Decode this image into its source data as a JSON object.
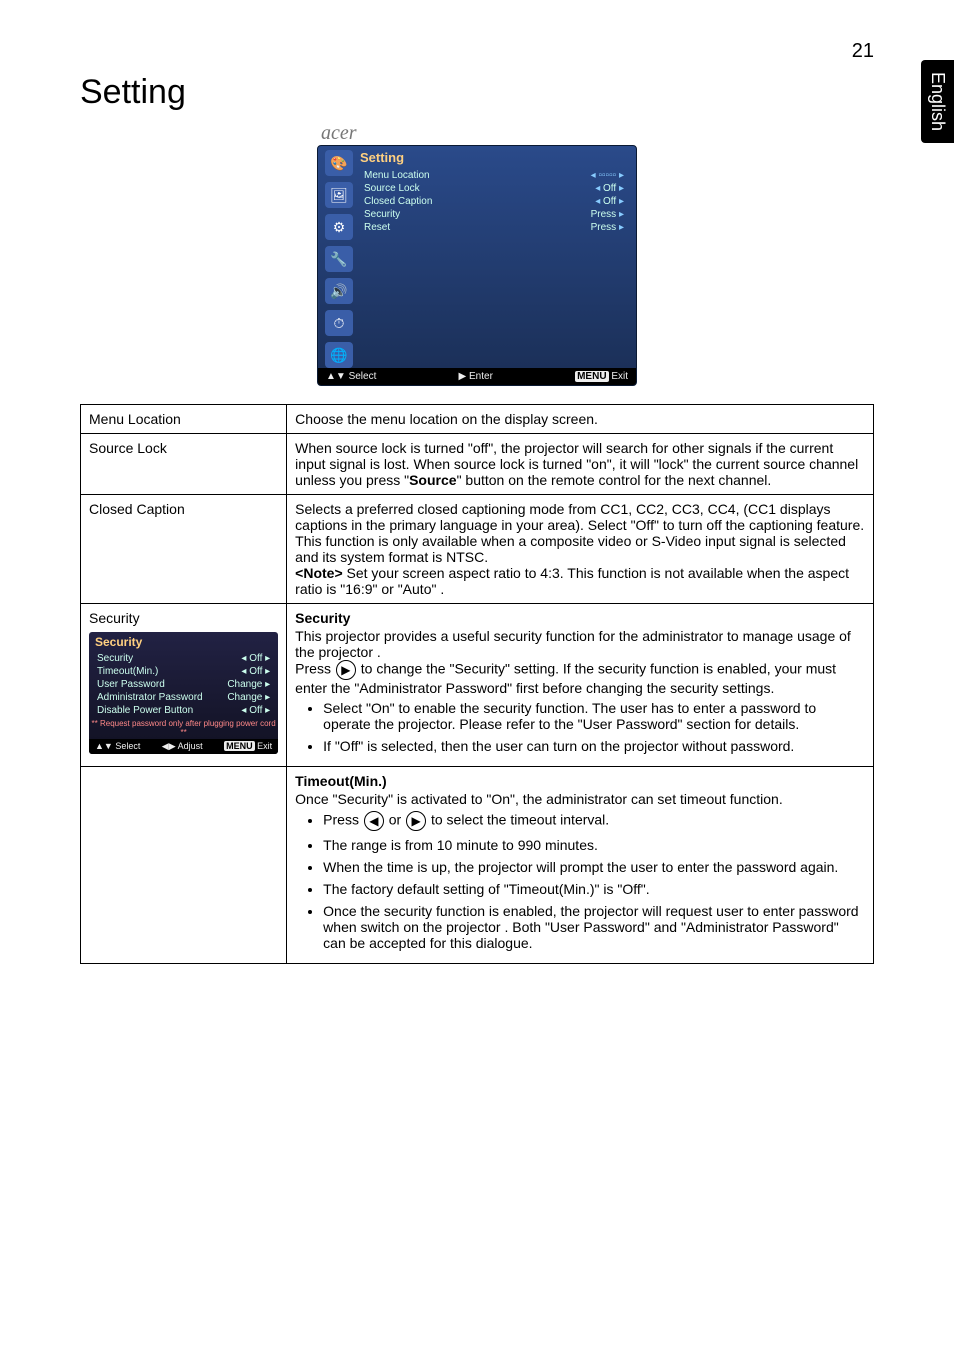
{
  "page_number": "21",
  "side_tab": "English",
  "heading": "Setting",
  "screenshot": {
    "brand": "acer",
    "title": "Setting",
    "rows": [
      {
        "label": "Menu Location",
        "value": ""
      },
      {
        "label": "Source Lock",
        "value": "Off"
      },
      {
        "label": "Closed Caption",
        "value": "Off"
      },
      {
        "label": "Security",
        "value": "Press"
      },
      {
        "label": "Reset",
        "value": "Press"
      }
    ],
    "footer": {
      "select": "▲▼ Select",
      "enter": "▶  Enter",
      "exit_badge": "MENU",
      "exit": "Exit"
    }
  },
  "security_inset": {
    "title": "Security",
    "rows": [
      {
        "label": "Security",
        "value": "Off"
      },
      {
        "label": "Timeout(Min.)",
        "value": "Off"
      },
      {
        "label": "User Password",
        "value": "Change"
      },
      {
        "label": "Administrator Password",
        "value": "Change"
      },
      {
        "label": "Disable Power Button",
        "value": "Off"
      }
    ],
    "note": "** Request password only after plugging power cord **",
    "footer": {
      "select": "▲▼ Select",
      "adjust": "◀▶ Adjust",
      "exit_badge": "MENU",
      "exit": "Exit"
    }
  },
  "table": {
    "menu_location": {
      "label": "Menu Location",
      "text": "Choose the menu location on the display screen."
    },
    "source_lock": {
      "label": "Source Lock",
      "text_parts": {
        "p1": "When source lock is turned \"off\", the projector will search for other signals if the current input signal is lost. When source lock is turned \"on\", it will \"lock\" the current source channel unless you press \"",
        "bold": "Source",
        "p2": "\" button on the remote control for the next channel."
      }
    },
    "closed_caption": {
      "label": "Closed Caption",
      "text_parts": {
        "p1": "Selects a preferred closed captioning mode from CC1, CC2, CC3, CC4, (CC1 displays captions in the primary language in your area). Select \"Off\" to turn off the captioning feature. This function is only available when a composite video or S-Video input signal is selected and its system format is NTSC.",
        "note_label": "<Note>",
        "p2": " Set your screen aspect ratio to 4:3. This function is not available when the aspect ratio is \"16:9\" or \"Auto\" ."
      }
    },
    "security": {
      "label": "Security",
      "block1": {
        "head": "Security",
        "intro": "This projector provides a useful security function for the administrator to manage usage of the projector .",
        "press_pre": "Press ",
        "press_post": " to change the \"Security\" setting. If the security function is enabled, your must enter the \"Administrator Password\" first before changing the security settings.",
        "bullets": [
          "Select \"On\" to enable the security function. The user has to enter a password to operate the projector. Please refer to the \"User Password\" section for details.",
          "If \"Off\" is selected, then the user can turn on the projector without password."
        ]
      },
      "block2": {
        "head": "Timeout(Min.)",
        "intro": "Once \"Security\" is activated to \"On\", the administrator can set timeout function.",
        "bullets_special": {
          "b1_pre": "Press ",
          "b1_mid": " or ",
          "b1_post": " to select the timeout interval."
        },
        "bullets": [
          "The range is from 10 minute to 990 minutes.",
          "When the time is up, the projector will prompt the user to enter the password again.",
          "The factory default setting of \"Timeout(Min.)\" is \"Off\".",
          "Once the security function is enabled, the projector will request user to enter password when switch on the projector . Both \"User Password\" and \"Administrator Password\" can be accepted for this dialogue."
        ]
      }
    }
  }
}
